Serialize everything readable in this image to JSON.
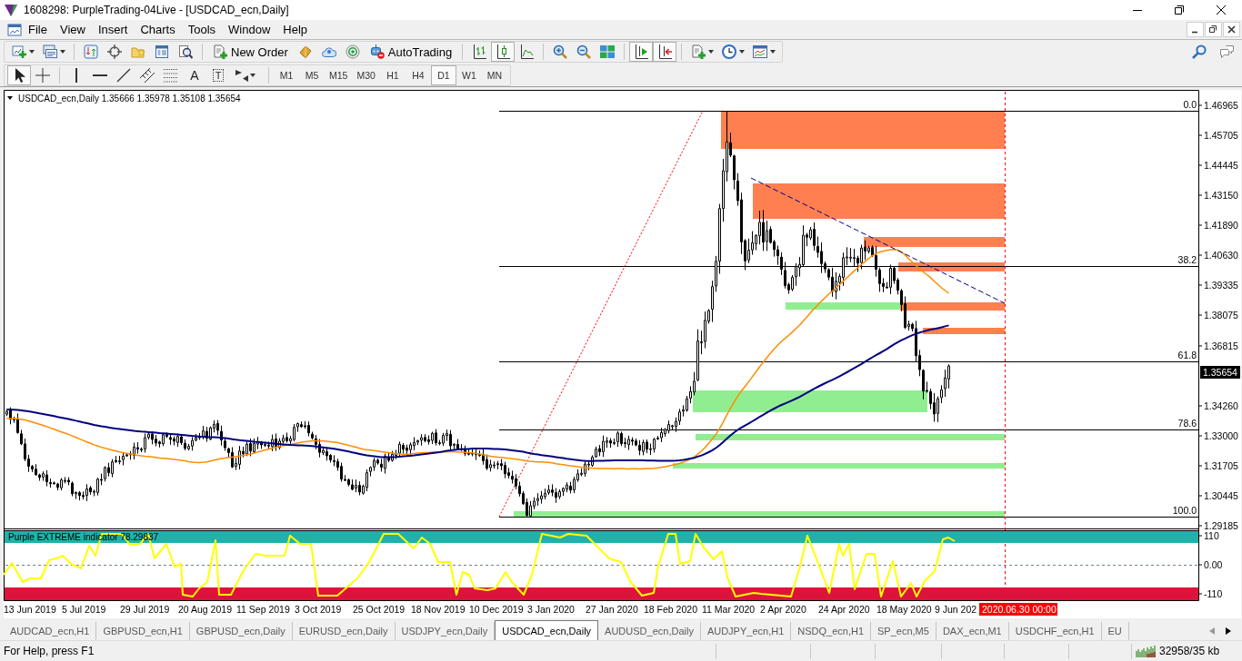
{
  "window": {
    "title": "1608298: PurpleTrading-04Live - [USDCAD_ecn,Daily]"
  },
  "menu": [
    "File",
    "View",
    "Insert",
    "Charts",
    "Tools",
    "Window",
    "Help"
  ],
  "toolbar": {
    "new_order": "New Order",
    "auto_trading": "AutoTrading",
    "chart_modes": [
      {
        "kind": "bars",
        "selected": false
      },
      {
        "kind": "candles",
        "selected": true
      },
      {
        "kind": "line",
        "selected": false
      }
    ],
    "chart_toggles": [
      {
        "kind": "auto-scroll",
        "on": true
      },
      {
        "kind": "chart-shift",
        "on": true
      }
    ]
  },
  "tools": [
    {
      "kind": "cursor",
      "selected": true
    },
    {
      "kind": "crosshair",
      "selected": false
    },
    {
      "kind": "vertical-line",
      "selected": false
    },
    {
      "kind": "horizontal-line",
      "selected": false
    },
    {
      "kind": "trend-line",
      "selected": false
    },
    {
      "kind": "channel",
      "selected": false
    },
    {
      "kind": "fibonacci",
      "selected": false
    },
    {
      "kind": "text",
      "glyph": "A",
      "selected": false
    },
    {
      "kind": "text-label",
      "glyph": "T",
      "selected": false
    },
    {
      "kind": "arrows",
      "selected": false
    }
  ],
  "timeframes": [
    {
      "label": "M1",
      "selected": false
    },
    {
      "label": "M5",
      "selected": false
    },
    {
      "label": "M15",
      "selected": false
    },
    {
      "label": "M30",
      "selected": false
    },
    {
      "label": "H1",
      "selected": false
    },
    {
      "label": "H4",
      "selected": false
    },
    {
      "label": "D1",
      "selected": true
    },
    {
      "label": "W1",
      "selected": false
    },
    {
      "label": "MN",
      "selected": false
    }
  ],
  "chart": {
    "header": "USDCAD_ecn,Daily 1.35666 1.35978 1.35108 1.35654",
    "price_ticks": [
      "1.46965",
      "1.45705",
      "1.44445",
      "1.43150",
      "1.41890",
      "1.40630",
      "1.39335",
      "1.38075",
      "1.36815",
      "1.34260",
      "1.33000",
      "1.31705",
      "1.30445",
      "1.29185"
    ],
    "current_price": "1.35654",
    "fib_levels": [
      "0.0",
      "38.2",
      "61.8",
      "78.6",
      "100.0"
    ],
    "indicator": {
      "label": "Purple EXTREME indicator 78.29837",
      "ticks": [
        "110",
        "0.00",
        "-110"
      ]
    },
    "dates": [
      "13 Jun 2019",
      "5 Jul 2019",
      "29 Jul 2019",
      "20 Aug 2019",
      "11 Sep 2019",
      "3 Oct 2019",
      "25 Oct 2019",
      "18 Nov 2019",
      "10 Dec 2019",
      "3 Jan 2020",
      "27 Jan 2020",
      "18 Feb 2020",
      "11 Mar 2020",
      "2 Apr 2020",
      "24 Apr 2020",
      "18 May 2020",
      "9 Jun 202"
    ],
    "cursor_date": "2020.06.30 00:00"
  },
  "tabs": [
    {
      "label": "AUDCAD_ecn,H1",
      "selected": false
    },
    {
      "label": "GBPUSD_ecn,H1",
      "selected": false
    },
    {
      "label": "GBPUSD_ecn,Daily",
      "selected": false
    },
    {
      "label": "EURUSD_ecn,Daily",
      "selected": false
    },
    {
      "label": "USDJPY_ecn,Daily",
      "selected": false
    },
    {
      "label": "USDCAD_ecn,Daily",
      "selected": true
    },
    {
      "label": "AUDUSD_ecn,Daily",
      "selected": false
    },
    {
      "label": "AUDJPY_ecn,H1",
      "selected": false
    },
    {
      "label": "NSDQ_ecn,H1",
      "selected": false
    },
    {
      "label": "SP_ecn,M5",
      "selected": false
    },
    {
      "label": "DAX_ecn,M1",
      "selected": false
    },
    {
      "label": "USDCHF_ecn,H1",
      "selected": false
    },
    {
      "label": "EU",
      "selected": false
    }
  ],
  "status_bar": {
    "help": "For Help, press F1",
    "traffic": "32958/35 kb"
  }
}
